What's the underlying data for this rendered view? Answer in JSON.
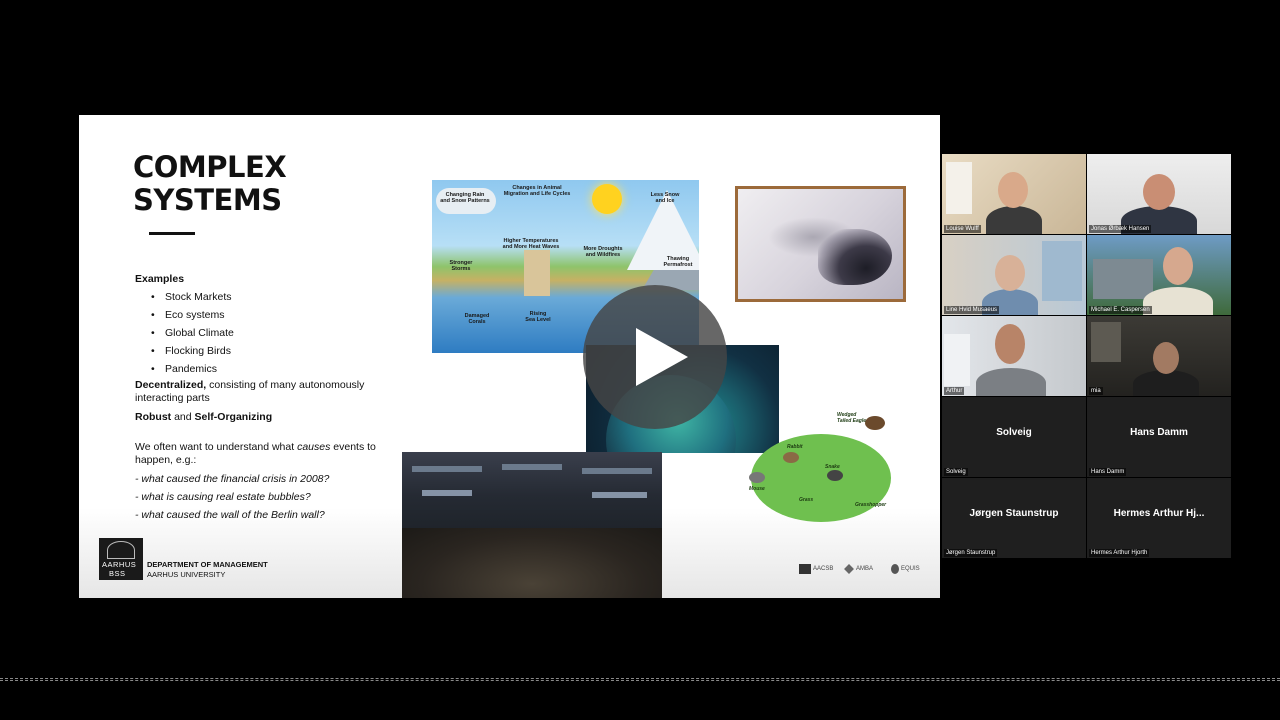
{
  "slide": {
    "title_line1": "COMPLEX",
    "title_line2": "SYSTEMS",
    "examples_heading": "Examples",
    "examples": [
      "Stock Markets",
      "Eco systems",
      "Global Climate",
      "Flocking Birds",
      "Pandemics"
    ],
    "decentralized_bold": "Decentralized,",
    "decentralized_rest": " consisting of many autonomously interacting parts",
    "robust_bold": "Robust",
    "robust_and": " and ",
    "selforg_bold": "Self-Organizing",
    "causes_pre": "We often want to understand what ",
    "causes_em": "causes",
    "causes_post": " events to happen, e.g.:",
    "questions": [
      "- what caused the financial crisis in 2008?",
      "- what is causing real estate bubbles?",
      "- what caused the wall of the Berlin wall?"
    ],
    "dept_line1": "DEPARTMENT OF MANAGEMENT",
    "dept_line2": "AARHUS UNIVERSITY",
    "logo_line1": "AARHUS",
    "logo_line2": "BSS",
    "accreditations": [
      "AACSB",
      "AMBA",
      "EQUIS"
    ],
    "climate_labels": {
      "rain": "Changing Rain and Snow Patterns",
      "animal": "Changes in Animal Migration and Life Cycles",
      "ice": "Less Snow and Ice",
      "temps": "Higher Temperatures and More Heat Waves",
      "storms": "Stronger Storms",
      "droughts": "More Droughts and Wildfires",
      "permafrost": "Thawing Permafrost",
      "corals": "Damaged Corals",
      "sea": "Rising Sea Level"
    },
    "food_labels": {
      "eagle": "Wedged Tailed Eagle",
      "rabbit": "Rabbit",
      "snake": "Snake",
      "mouse": "Mouse",
      "grass": "Grass",
      "grasshopper": "Grasshopper"
    }
  },
  "participants": [
    {
      "label": "Louise Wulff"
    },
    {
      "label": "Jonas Ørbæk Hansen"
    },
    {
      "label": "Line Hvid Musaeus"
    },
    {
      "label": "Michael E. Caspersen"
    },
    {
      "label": "Arthur"
    },
    {
      "label": "mia"
    },
    {
      "label": "Solveig",
      "display": "Solveig"
    },
    {
      "label": "Hans Damm",
      "display": "Hans Damm"
    },
    {
      "label": "Jørgen Staunstrup",
      "display": "Jørgen Staunstrup"
    },
    {
      "label": "Hermes Arthur Hjorth",
      "display": "Hermes Arthur Hj..."
    }
  ]
}
